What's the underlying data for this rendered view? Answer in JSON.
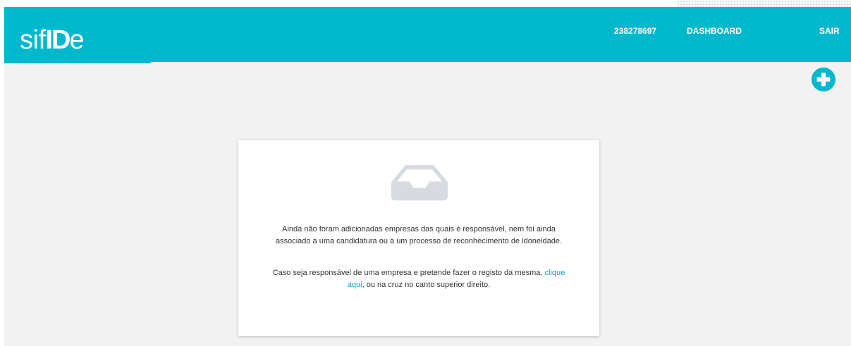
{
  "header": {
    "logo_light": "sif",
    "logo_bold": "ID",
    "logo_end": "e",
    "nif": "238278697",
    "dashboard": "DASHBOARD",
    "logout": "SAIR"
  },
  "colors": {
    "accent": "#00b8cc",
    "background": "#f2f2f2",
    "link": "#00a7c4",
    "icon_gray": "#d7dadf"
  },
  "add_button": {
    "icon": "plus-circle-icon"
  },
  "empty_state": {
    "icon": "inbox-tray-icon",
    "paragraph1": "Ainda não foram adicionadas empresas das quais é responsável, nem foi ainda associado a uma candidatura ou a um processo de reconhecimento de idoneidade.",
    "p2_before": "Caso seja responsável de uma empresa e pretende fazer o registo da mesma, ",
    "p2_link": "clique aqui",
    "p2_after": ", ou na cruz no canto superior direito."
  }
}
